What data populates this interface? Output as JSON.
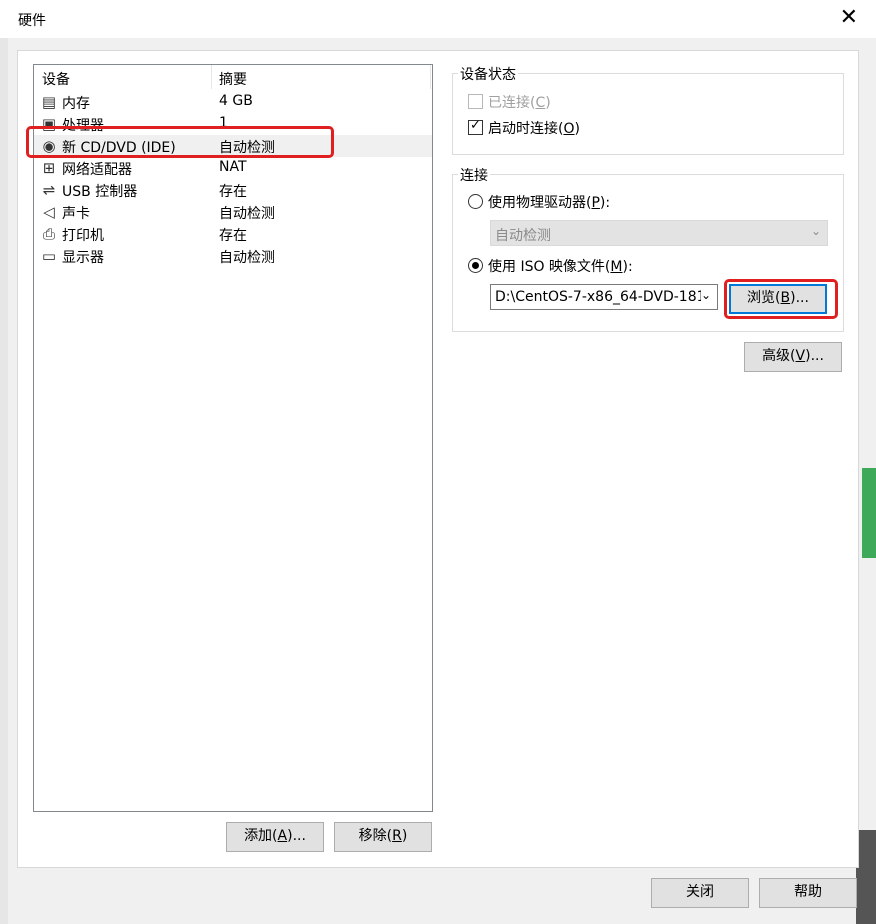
{
  "window": {
    "title": "硬件",
    "close_glyph": "✕"
  },
  "device_list": {
    "headers": {
      "device": "设备",
      "summary": "摘要"
    },
    "rows": [
      {
        "icon": "memory-icon",
        "glyph": "▤",
        "name": "内存",
        "summary": "4 GB"
      },
      {
        "icon": "processor-icon",
        "glyph": "▣",
        "name": "处理器",
        "summary": "1"
      },
      {
        "icon": "cd-dvd-icon",
        "glyph": "◉",
        "name": "新 CD/DVD (IDE)",
        "summary": "自动检测"
      },
      {
        "icon": "network-adapter-icon",
        "glyph": "⊞",
        "name": "网络适配器",
        "summary": "NAT"
      },
      {
        "icon": "usb-icon",
        "glyph": "⇌",
        "name": "USB 控制器",
        "summary": "存在"
      },
      {
        "icon": "sound-card-icon",
        "glyph": "◁",
        "name": "声卡",
        "summary": "自动检测"
      },
      {
        "icon": "printer-icon",
        "glyph": "⎙",
        "name": "打印机",
        "summary": "存在"
      },
      {
        "icon": "display-icon",
        "glyph": "▭",
        "name": "显示器",
        "summary": "自动检测"
      }
    ],
    "add_button": {
      "label": "添加(",
      "key": "A",
      "suffix": ")..."
    },
    "remove_button": {
      "label": "移除(",
      "key": "R",
      "suffix": ")"
    }
  },
  "device_status": {
    "title": "设备状态",
    "connected": {
      "label": "已连接(",
      "key": "C",
      "suffix": ")",
      "checked": false,
      "disabled": true
    },
    "connect_at_power_on": {
      "label": "启动时连接(",
      "key": "O",
      "suffix": ")",
      "checked": true
    }
  },
  "connection": {
    "title": "连接",
    "physical_drive": {
      "label": "使用物理驱动器(",
      "key": "P",
      "suffix": "):",
      "selected": false
    },
    "physical_drive_select": {
      "value": "自动检测",
      "disabled": true
    },
    "iso_image": {
      "label": "使用 ISO 映像文件(",
      "key": "M",
      "suffix": "):",
      "selected": true
    },
    "iso_path": "D:\\CentOS-7-x86_64-DVD-181",
    "browse_button": {
      "label": "浏览(",
      "key": "B",
      "suffix": ")..."
    }
  },
  "advanced_button": {
    "label": "高级(",
    "key": "V",
    "suffix": ")..."
  },
  "footer": {
    "close_label": "关闭",
    "help_label": "帮助"
  },
  "colors": {
    "highlight_box": "#e02020",
    "focus_border": "#0078d7"
  }
}
